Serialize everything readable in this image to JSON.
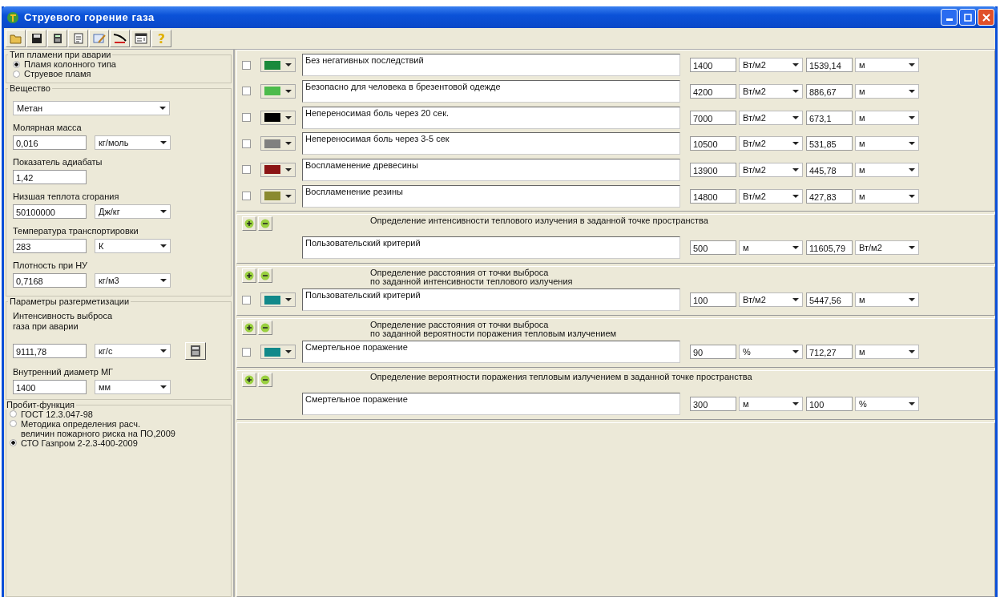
{
  "window": {
    "title": "Струевого горение газа"
  },
  "toolbar": [
    {
      "kind": "open"
    },
    {
      "kind": "save"
    },
    {
      "kind": "calc"
    },
    {
      "kind": "doc"
    },
    {
      "kind": "edit"
    },
    {
      "kind": "curve"
    },
    {
      "kind": "report"
    },
    {
      "kind": "help",
      "glyph": "?"
    }
  ],
  "flame_type": {
    "title": "Тип пламени при аварии",
    "options": [
      {
        "label": "Пламя колонного типа",
        "selected": true
      },
      {
        "label": "Струевое пламя",
        "selected": false
      }
    ]
  },
  "substance": {
    "title": "Вещество",
    "value": "Метан",
    "fields": [
      {
        "label": "Молярная масса",
        "value": "0,016",
        "unit": "кг/моль"
      },
      {
        "label": "Показатель адиабаты",
        "value": "1,42"
      },
      {
        "label": "Низшая теплота сгорания",
        "value": "50100000",
        "unit": "Дж/кг"
      },
      {
        "label": "Температура транспортировки",
        "value": "283",
        "unit": "К"
      },
      {
        "label": "Плотность при НУ",
        "value": "0,7168",
        "unit": "кг/м3"
      }
    ]
  },
  "depressurization": {
    "title": "Параметры разгерметизации",
    "fields": [
      {
        "label": "Интенсивность выброса\nгаза при аварии",
        "value": "9111,78",
        "unit": "кг/с",
        "calculator": true
      },
      {
        "label": "Внутренний диаметр МГ",
        "value": "1400",
        "unit": "мм"
      }
    ]
  },
  "probit": {
    "title": "Пробит-функция",
    "options": [
      {
        "label": "ГОСТ 12.3.047-98",
        "selected": false
      },
      {
        "label": "Методика определения расч.\nвеличин пожарного риска на ПО,2009",
        "selected": false
      },
      {
        "label": "СТО Газпром 2-2.3-400-2009",
        "selected": true
      }
    ]
  },
  "criteria": [
    {
      "checked": false,
      "color": "#1a8a3c",
      "description": "Без негативных последствий",
      "input": "1400",
      "input_unit": "Вт/м2",
      "result": "1539,14",
      "result_unit": "м"
    },
    {
      "checked": false,
      "color": "#4cbb4c",
      "description": "Безопасно для человека в брезентовой одежде",
      "input": "4200",
      "input_unit": "Вт/м2",
      "result": "886,67",
      "result_unit": "м"
    },
    {
      "checked": false,
      "color": "#000000",
      "description": "Непереносимая боль через 20 сек.",
      "input": "7000",
      "input_unit": "Вт/м2",
      "result": "673,1",
      "result_unit": "м"
    },
    {
      "checked": false,
      "color": "#808080",
      "description": "Непереносимая боль через 3-5 сек",
      "input": "10500",
      "input_unit": "Вт/м2",
      "result": "531,85",
      "result_unit": "м"
    },
    {
      "checked": false,
      "color": "#8b1414",
      "description": "Воспламенение древесины",
      "input": "13900",
      "input_unit": "Вт/м2",
      "result": "445,78",
      "result_unit": "м"
    },
    {
      "checked": false,
      "color": "#8a8a30",
      "description": "Воспламенение резины",
      "input": "14800",
      "input_unit": "Вт/м2",
      "result": "427,83",
      "result_unit": "м"
    }
  ],
  "sections": [
    {
      "title": "Определение интенсивности теплового излучения в заданной точке пространства",
      "description": "Пользовательский критерий",
      "input": "500",
      "input_unit": "м",
      "result": "11605,79",
      "result_unit": "Вт/м2"
    },
    {
      "title": "Определение расстояния от точки выброса\n по заданной интенсивности теплового излучения",
      "picker": {
        "checked": false,
        "color": "#12898a"
      },
      "description": "Пользовательский критерий",
      "input": "100",
      "input_unit": "Вт/м2",
      "result": "5447,56",
      "result_unit": "м"
    },
    {
      "title": "Определение расстояния от точки выброса\nпо заданной вероятности поражения тепловым излучением",
      "picker": {
        "checked": false,
        "color": "#12898a"
      },
      "description": "Смертельное поражение",
      "input": "90",
      "input_unit": "%",
      "result": "712,27",
      "result_unit": "м"
    },
    {
      "title": "Определение вероятности поражения тепловым излучением в заданной точке пространства",
      "description": "Смертельное поражение",
      "input": "300",
      "input_unit": "м",
      "result": "100",
      "result_unit": "%"
    }
  ]
}
